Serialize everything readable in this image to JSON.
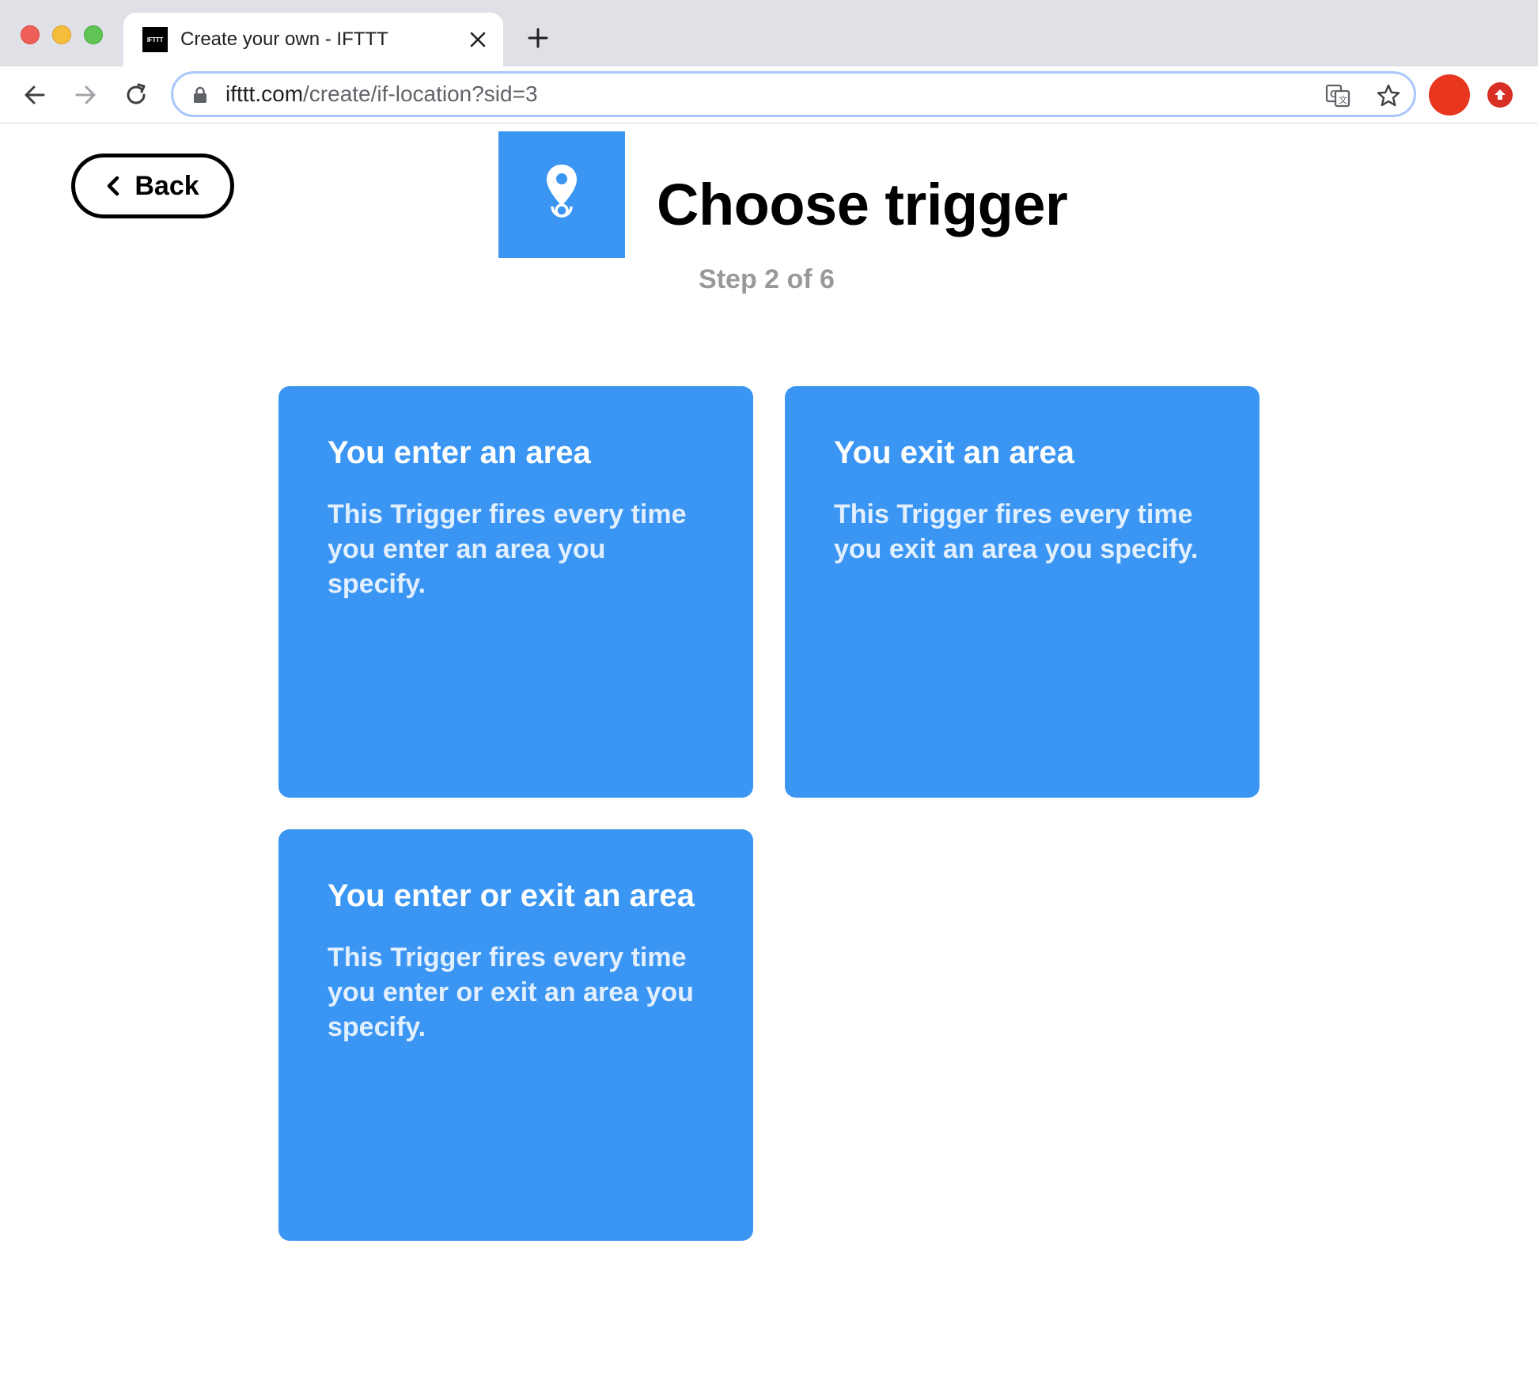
{
  "browser": {
    "tab": {
      "favicon_text": "IFTTT",
      "title": "Create your own - IFTTT"
    },
    "address_bar": {
      "host": "ifttt.com",
      "path": "/create/if-location?sid=3"
    },
    "icons": {
      "back": "arrow-left-icon",
      "forward": "arrow-right-icon",
      "reload": "reload-icon",
      "lock": "lock-icon",
      "translate": "translate-icon",
      "bookmark": "star-icon",
      "new_tab": "plus-icon",
      "close_tab": "close-icon"
    }
  },
  "page": {
    "back_label": "Back",
    "title": "Choose trigger",
    "step": "Step 2 of 6",
    "service_icon": "location-pin-icon",
    "accent_color": "#3b96f3"
  },
  "triggers": [
    {
      "title": "You enter an area",
      "description": "This Trigger fires every time you enter an area you specify."
    },
    {
      "title": "You exit an area",
      "description": "This Trigger fires every time you exit an area you specify."
    },
    {
      "title": "You enter or exit an area",
      "description": "This Trigger fires every time you enter or exit an area you specify."
    }
  ]
}
